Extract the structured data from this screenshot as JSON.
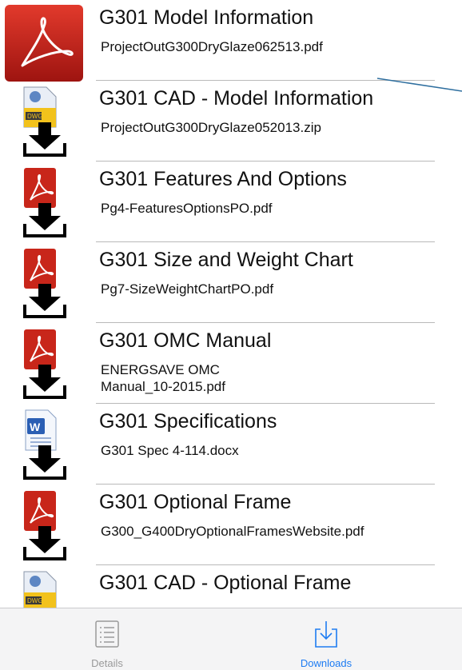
{
  "items": [
    {
      "title": "G301 Model Information",
      "file": "ProjectOutG300DryGlaze062513.pdf",
      "icon": "acrobat-large-icon"
    },
    {
      "title": "G301 CAD - Model Information",
      "file": "ProjectOutG300DryGlaze052013.zip",
      "icon": "dwg-file-icon",
      "badge": "DWG"
    },
    {
      "title": "G301 Features And Options",
      "file": "Pg4-FeaturesOptionsPO.pdf",
      "icon": "pdf-file-icon"
    },
    {
      "title": "G301 Size and Weight Chart",
      "file": "Pg7-SizeWeightChartPO.pdf",
      "icon": "pdf-file-icon"
    },
    {
      "title": "G301 OMC Manual",
      "file": "ENERGSAVE OMC Manual_10-2015.pdf",
      "icon": "pdf-file-icon"
    },
    {
      "title": "G301 Specifications",
      "file": "G301 Spec 4-114.docx",
      "icon": "word-file-icon"
    },
    {
      "title": "G301 Optional Frame",
      "file": "G300_G400DryOptionalFramesWebsite.pdf",
      "icon": "pdf-file-icon"
    },
    {
      "title": "G301 CAD - Optional Frame",
      "file": "",
      "icon": "dwg-file-icon",
      "badge": "DWG"
    }
  ],
  "tabs": [
    {
      "label": "Details",
      "icon": "list-icon",
      "selected": false
    },
    {
      "label": "Downloads",
      "icon": "download-tray-icon",
      "selected": true
    }
  ],
  "colors": {
    "accent": "#1e7cf2",
    "pdf_red": "#c8261a",
    "separator": "#b9b9b9",
    "tab_inactive": "#9a9a9a",
    "tabbar_bg": "#f4f4f5",
    "callout_line": "#2f6f9f"
  }
}
